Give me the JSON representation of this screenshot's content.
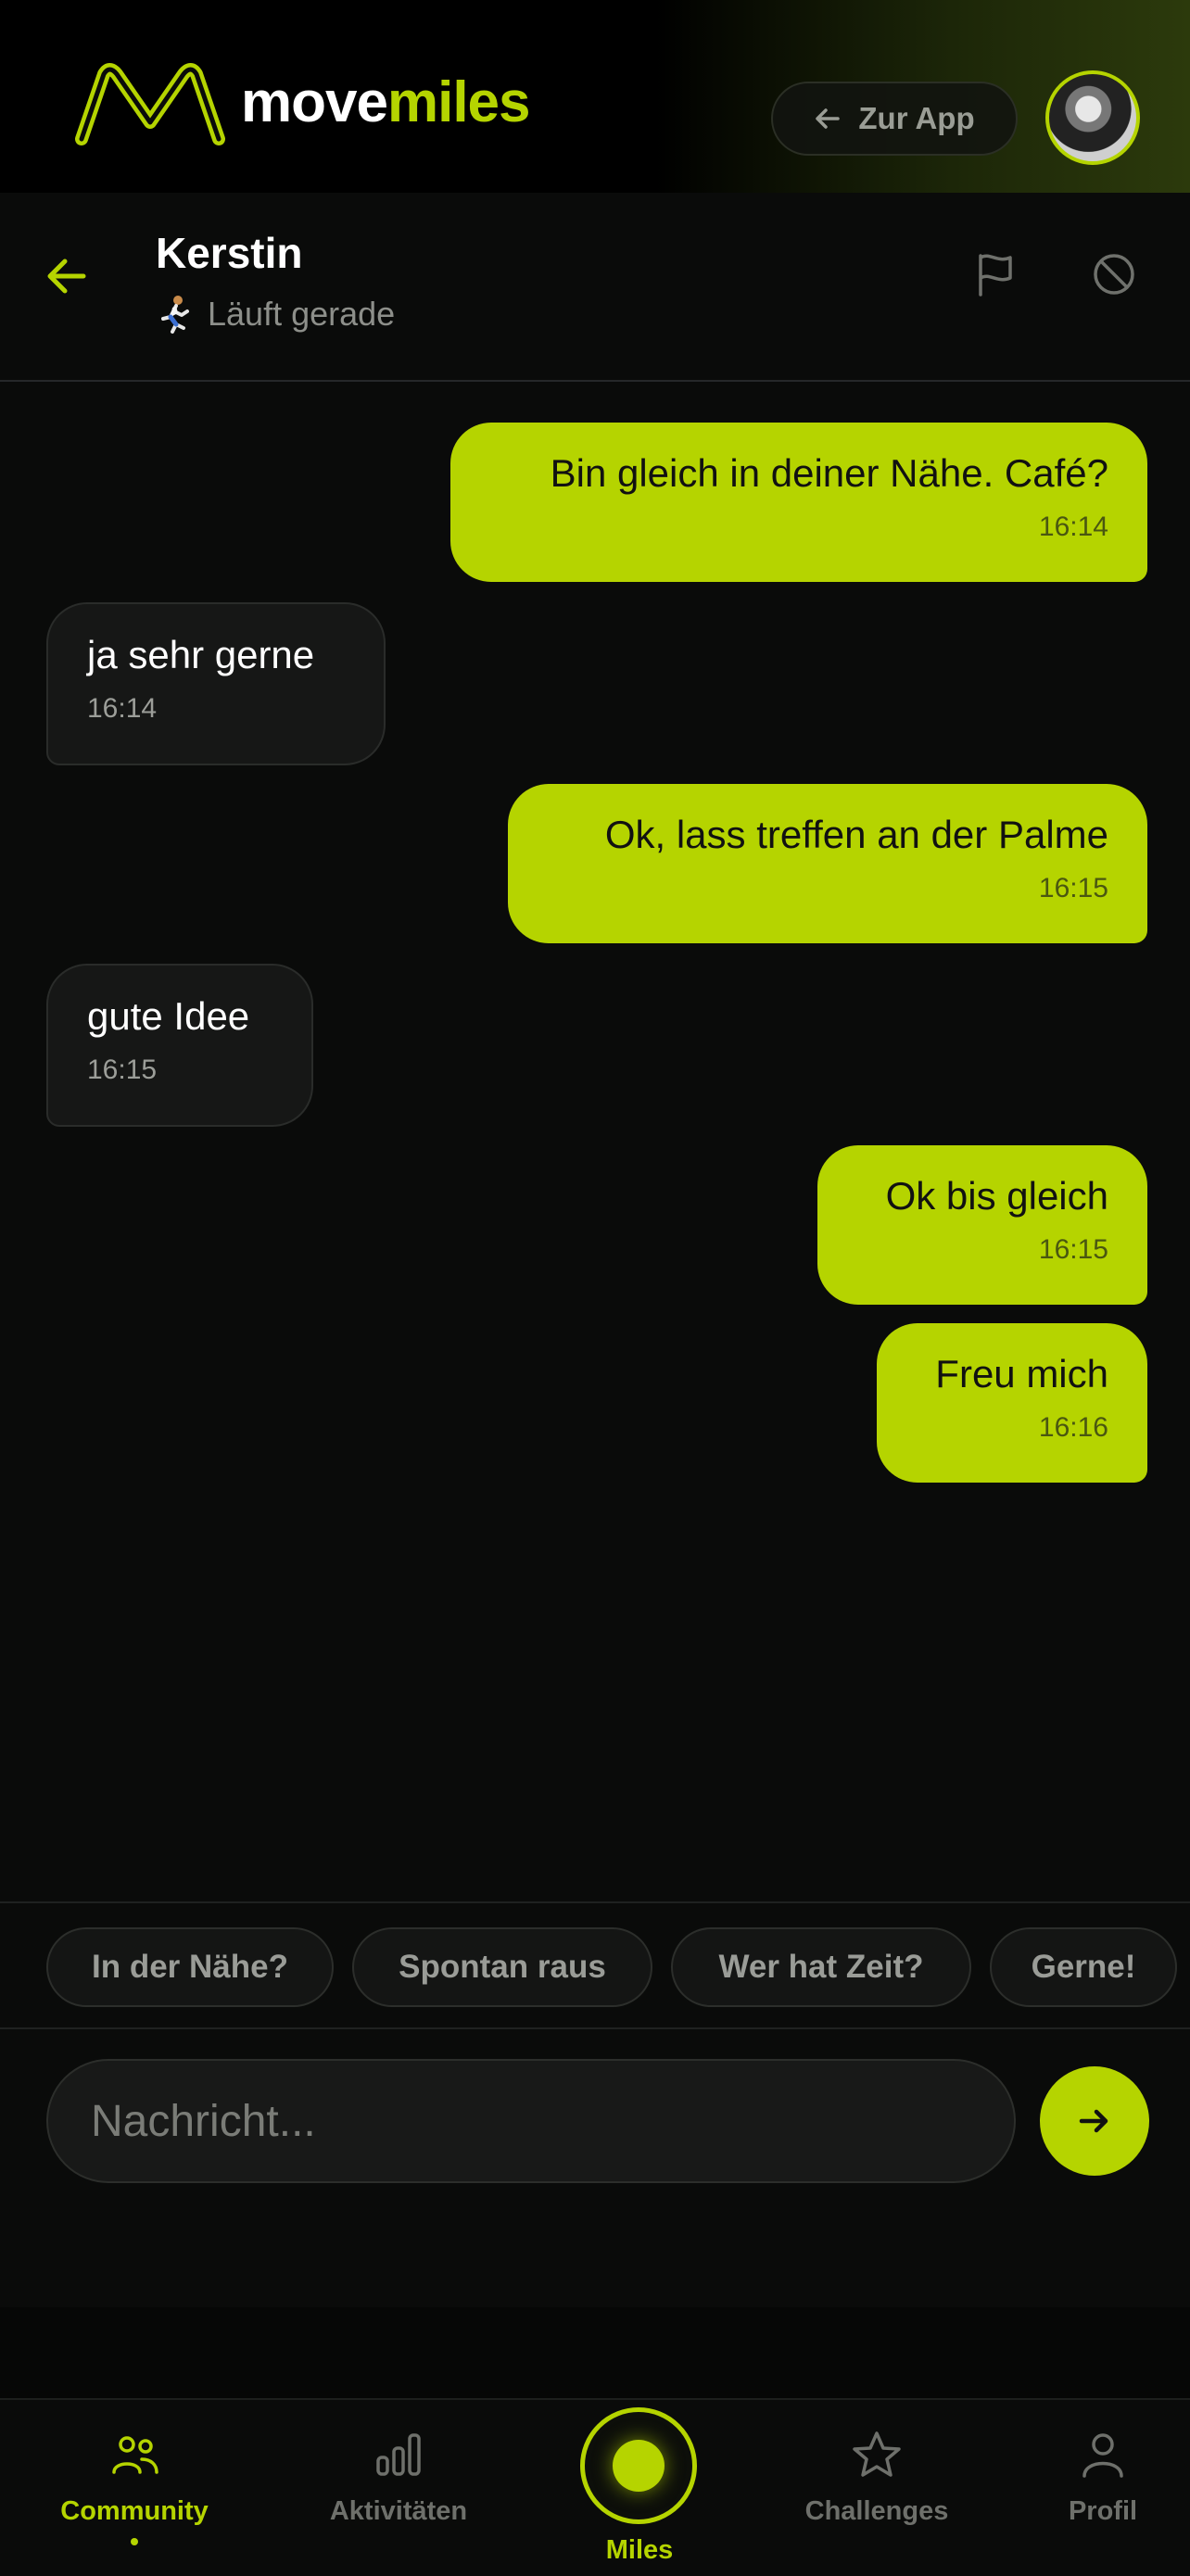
{
  "header": {
    "logo_part1": "move",
    "logo_part2": "miles",
    "back_to_app_label": "Zur App"
  },
  "chat": {
    "contact_name": "Kerstin",
    "status_text": "Läuft gerade",
    "status_icon": "runner-emoji"
  },
  "messages": [
    {
      "direction": "out",
      "text": "Bin gleich in deiner Nähe. Café?",
      "time": "16:14"
    },
    {
      "direction": "in",
      "text": "ja sehr gerne",
      "time": "16:14"
    },
    {
      "direction": "out",
      "text": "Ok, lass treffen an der Palme",
      "time": "16:15"
    },
    {
      "direction": "in",
      "text": "gute Idee",
      "time": "16:15"
    },
    {
      "direction": "out",
      "text": "Ok bis gleich",
      "time": "16:15"
    },
    {
      "direction": "out",
      "text": "Freu mich",
      "time": "16:16"
    }
  ],
  "quick_replies": [
    "In der Nähe?",
    "Spontan raus",
    "Wer hat Zeit?",
    "Gerne!"
  ],
  "composer": {
    "placeholder": "Nachricht..."
  },
  "nav": {
    "items": [
      {
        "label": "Community",
        "icon": "people-icon",
        "active": true
      },
      {
        "label": "Aktivitäten",
        "icon": "bar-chart-icon",
        "active": false
      },
      {
        "label": "Miles",
        "icon": "miles-dot-icon",
        "active": true
      },
      {
        "label": "Challenges",
        "icon": "star-icon",
        "active": false
      },
      {
        "label": "Profil",
        "icon": "person-icon",
        "active": false
      }
    ]
  },
  "colors": {
    "accent": "#b5d400",
    "background": "#0a0b0a",
    "incoming_bubble": "#161716"
  }
}
